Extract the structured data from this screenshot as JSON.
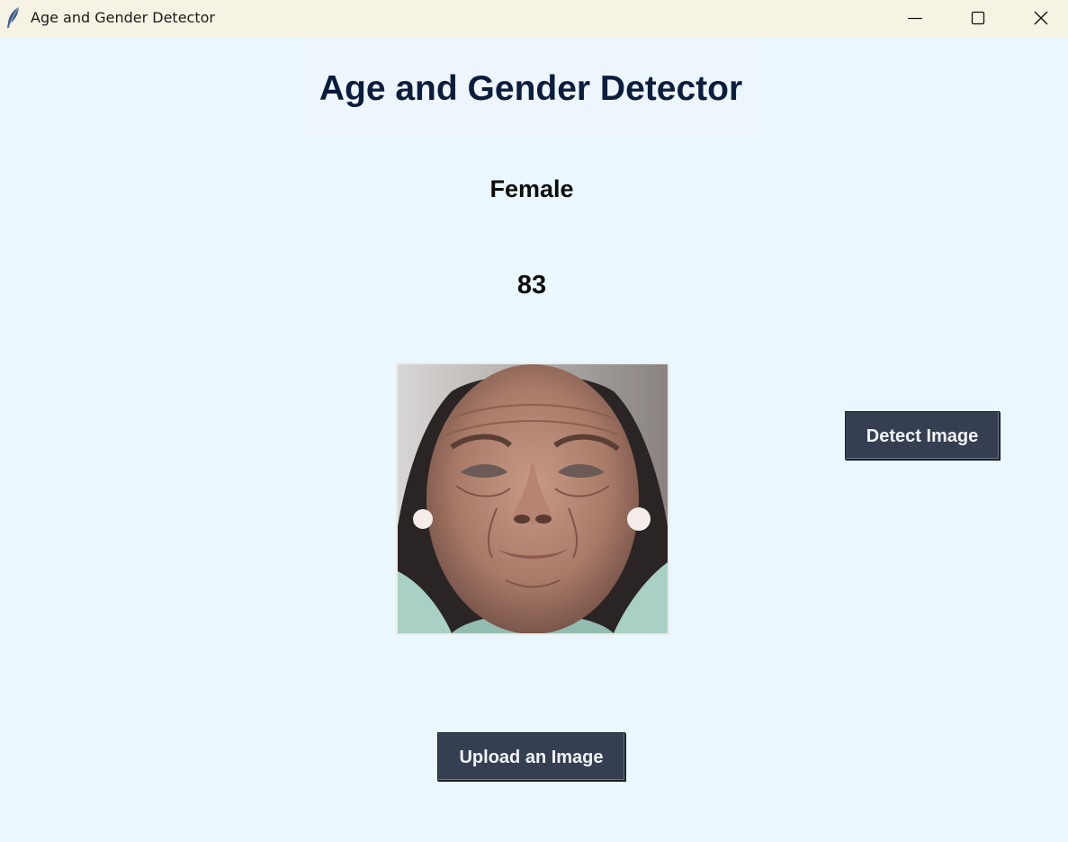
{
  "window": {
    "title": "Age and Gender Detector",
    "icon": "feather-icon",
    "controls": [
      "minimize-icon",
      "maximize-icon",
      "close-icon"
    ]
  },
  "main": {
    "heading": "Age and Gender Detector",
    "gender_result": "Female",
    "age_result": "83",
    "photo": "face-photo-elderly-woman",
    "detect_button_label": "Detect Image",
    "upload_button_label": "Upload an Image"
  },
  "colors": {
    "background": "#eaf7fe",
    "titlebar": "#f7f3e4",
    "heading_text": "#0b1d3c",
    "button_bg": "#363f52",
    "button_text": "#f2f4f7"
  }
}
